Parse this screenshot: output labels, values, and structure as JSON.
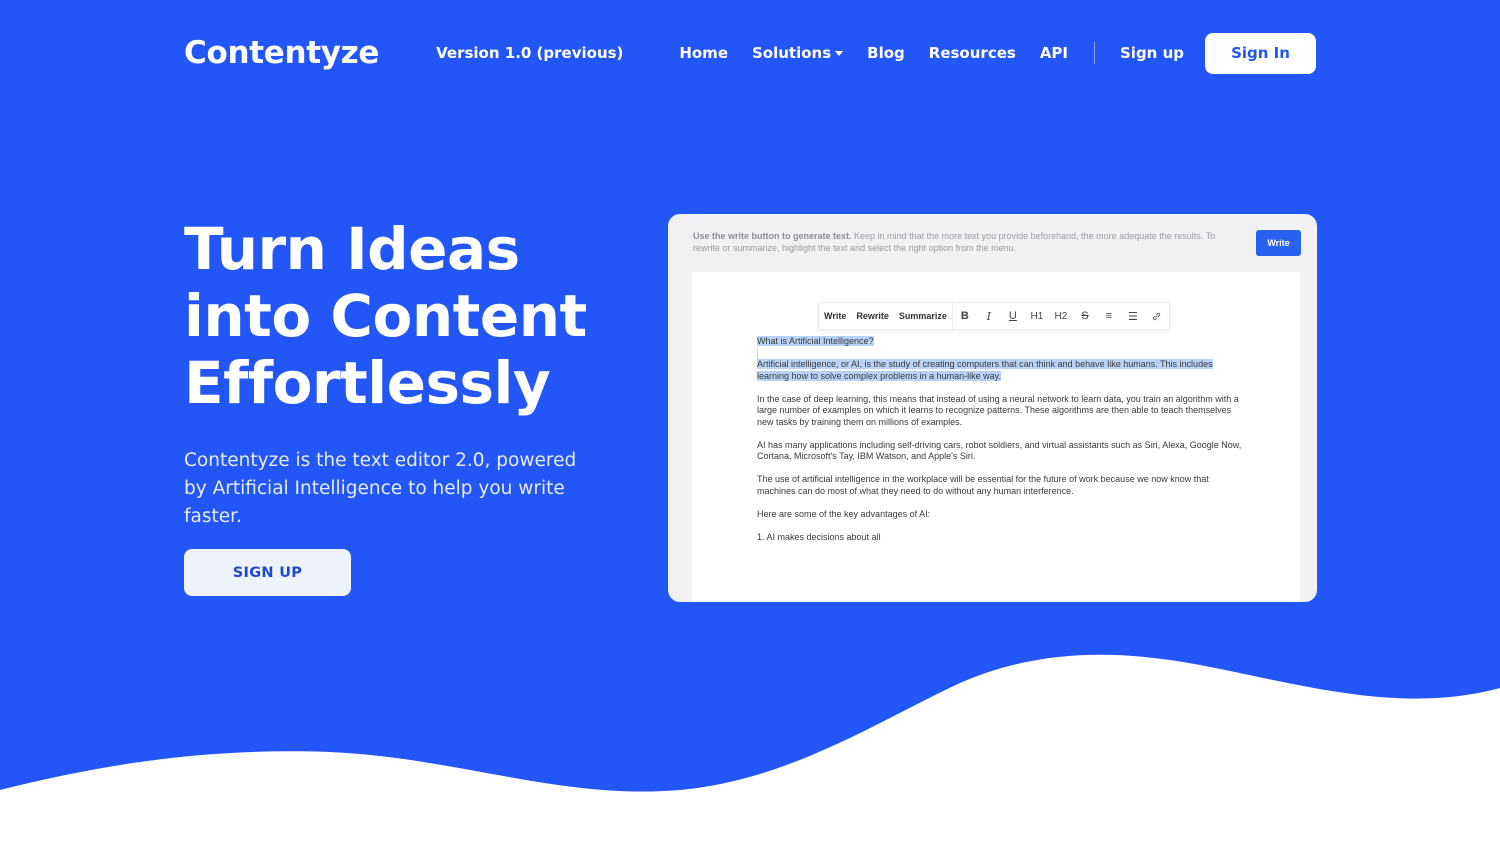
{
  "nav": {
    "logo": "Contentyze",
    "version": "Version 1.0 (previous)",
    "links": [
      "Home",
      "Solutions",
      "Blog",
      "Resources",
      "API"
    ],
    "signup": "Sign up",
    "signin": "Sign In"
  },
  "hero": {
    "title_lines": [
      "Turn Ideas",
      "into Content",
      "Effortlessly"
    ],
    "subtitle": "Contentyze is the text editor 2.0, powered by Artificial Intelligence to help you write faster.",
    "cta": "SIGN UP"
  },
  "editor": {
    "hint_bold": "Use the write button to generate text.",
    "hint_rest": " Keep in mind that the more text you provide beforehand, the more adequate the results. To rewrite or summarize, highlight the text and select the right option from the menu.",
    "write_button": "Write",
    "toolbar": {
      "words": [
        "Write",
        "Rewrite",
        "Summarize"
      ],
      "icons": [
        "B",
        "I",
        "U",
        "H1",
        "H2",
        "S",
        "≡",
        "☰",
        "🔗"
      ]
    },
    "doc": {
      "heading": "What is Artificial Intelligence?",
      "p1": "Artificial intelligence, or AI, is the study of creating computers that can think and behave like humans. This includes learning how to solve complex problems in a human-like way.",
      "p2": "In the case of deep learning, this means that instead of using a neural network to learn data, you train an algorithm with a large number of examples on which it learns to recognize patterns. These algorithms are then able to teach themselves new tasks by training them on millions of examples.",
      "p3": "AI has many applications including self-driving cars, robot soldiers, and virtual assistants such as Siri, Alexa, Google Now, Cortana, Microsoft's Tay, IBM Watson, and Apple's Siri.",
      "p4": "The use of artificial intelligence in the workplace will be essential for the future of work because we now know that machines can do most of what they need to do without any human interference.",
      "p5": "Here are some of the key advantages of AI:",
      "p6": "1. AI makes decisions about all"
    }
  },
  "colors": {
    "brand_blue": "#2356f6",
    "button_blue": "#2962f0",
    "highlight": "#b9d3f7",
    "white": "#ffffff"
  }
}
